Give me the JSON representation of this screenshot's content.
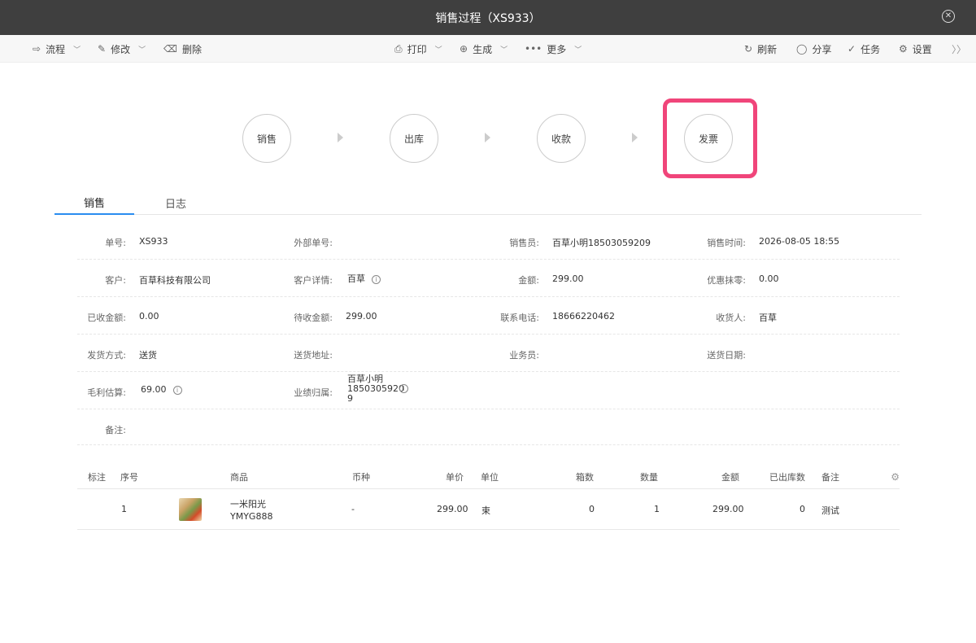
{
  "window": {
    "title": "销售过程（XS933）"
  },
  "toolbar": {
    "left": [
      {
        "label": "流程",
        "icon": "flow-icon",
        "glyph": "⇨",
        "dropdown": true
      },
      {
        "label": "修改",
        "icon": "edit-icon",
        "glyph": "✎",
        "dropdown": true
      },
      {
        "label": "删除",
        "icon": "trash-icon",
        "glyph": "🗑",
        "dropdown": false
      }
    ],
    "center": [
      {
        "label": "打印",
        "icon": "printer-icon",
        "glyph": "⎙",
        "dropdown": true
      },
      {
        "label": "生成",
        "icon": "plus-circle-icon",
        "glyph": "⊕",
        "dropdown": true
      },
      {
        "label": "更多",
        "icon": "more-dots-icon",
        "glyph": "•••",
        "dropdown": true
      }
    ],
    "right": [
      {
        "label": "刷新",
        "icon": "refresh-icon",
        "glyph": "↻"
      },
      {
        "label": "分享",
        "icon": "chat-bubble-icon",
        "glyph": "◯"
      },
      {
        "label": "任务",
        "icon": "check-circle-icon",
        "glyph": "✓"
      },
      {
        "label": "设置",
        "icon": "gear-icon",
        "glyph": "⚙"
      }
    ],
    "expand_glyph": "〉〉"
  },
  "steps": [
    {
      "label": "销售"
    },
    {
      "label": "出库"
    },
    {
      "label": "收款"
    },
    {
      "label": "发票",
      "highlighted": true
    }
  ],
  "accent_color": "#2a8df0",
  "highlight_color": "#f0457a",
  "tabs": [
    {
      "label": "销售",
      "active": true
    },
    {
      "label": "日志",
      "active": false
    }
  ],
  "form": {
    "rows": [
      [
        {
          "label": "单号:",
          "value": "XS933"
        },
        {
          "label": "外部单号:",
          "value": ""
        },
        {
          "label": "销售员:",
          "value": "百草小明18503059209"
        },
        {
          "label": "销售时间:",
          "value": "2026-08-05 18:55"
        }
      ],
      [
        {
          "label": "客户:",
          "value": "百草科技有限公司"
        },
        {
          "label": "客户详情:",
          "value": "百草",
          "info": true
        },
        {
          "label": "金额:",
          "value": "299.00"
        },
        {
          "label": "优惠抹零:",
          "value": "0.00"
        }
      ],
      [
        {
          "label": "已收金额:",
          "value": "0.00"
        },
        {
          "label": "待收金额:",
          "value": "299.00"
        },
        {
          "label": "联系电话:",
          "value": "18666220462"
        },
        {
          "label": "收货人:",
          "value": "百草"
        }
      ],
      [
        {
          "label": "发货方式:",
          "value": "送货"
        },
        {
          "label": "送货地址:",
          "value": ""
        },
        {
          "label": "业务员:",
          "value": ""
        },
        {
          "label": "送货日期:",
          "value": ""
        }
      ],
      [
        {
          "label": "毛利估算:",
          "value": "69.00",
          "info": true
        },
        {
          "label": "业绩归属:",
          "value_lines": [
            "百草小明",
            "1850305920",
            "9"
          ],
          "info": true
        }
      ],
      [
        {
          "label": "备注:",
          "value": ""
        }
      ]
    ]
  },
  "table": {
    "headers": [
      "标注",
      "序号",
      "商品",
      "币种",
      "单价",
      "单位",
      "箱数",
      "数量",
      "金额",
      "已出库数",
      "备注"
    ],
    "rows": [
      {
        "mark": "",
        "index": "1",
        "product_name": "一米阳光",
        "product_code": "YMYG888",
        "currency": "-",
        "unit_price": "299.00",
        "unit": "束",
        "boxes": "0",
        "quantity": "1",
        "amount": "299.00",
        "shipped": "0",
        "remark": "测试"
      }
    ]
  }
}
